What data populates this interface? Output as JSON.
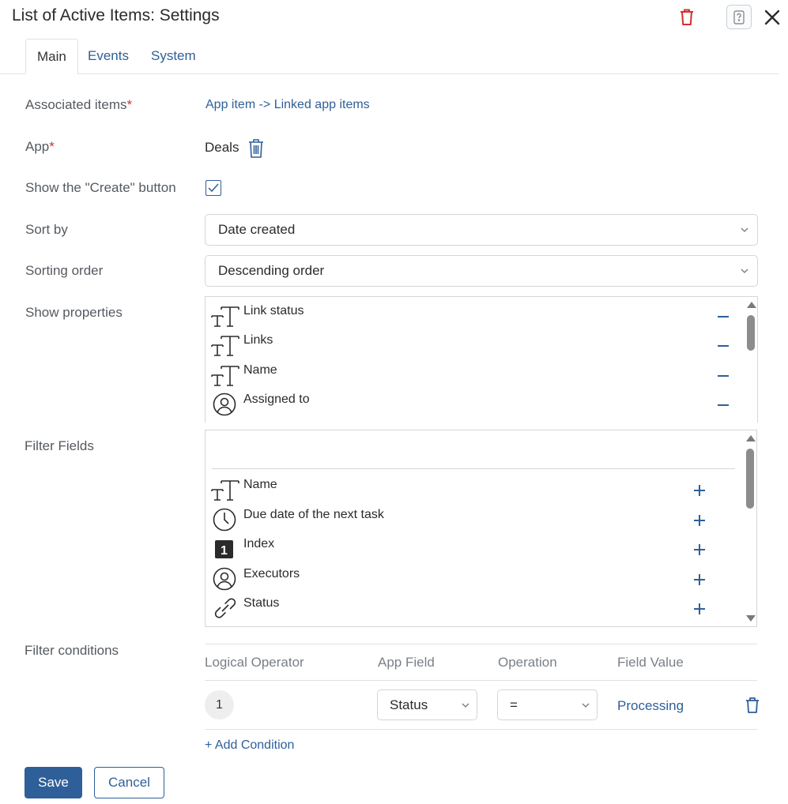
{
  "dialog": {
    "title": "List of Active Items: Settings"
  },
  "tabs": [
    {
      "label": "Main"
    },
    {
      "label": "Events"
    },
    {
      "label": "System"
    }
  ],
  "fields": {
    "associated_items": {
      "label": "Associated items",
      "required_mark": "*",
      "value": "App item -> Linked app items"
    },
    "app": {
      "label": "App",
      "required_mark": "*",
      "value": "Deals"
    },
    "show_create": {
      "label": "Show the \"Create\" button",
      "checked": true
    },
    "sort_by": {
      "label": "Sort by",
      "value": "Date created"
    },
    "sorting_order": {
      "label": "Sorting order",
      "value": "Descending order"
    },
    "show_properties": {
      "label": "Show properties"
    },
    "filter_fields": {
      "label": "Filter Fields"
    },
    "filter_conditions": {
      "label": "Filter conditions"
    }
  },
  "show_properties_items": [
    {
      "label": "Link status",
      "icon": "text-type-icon",
      "action": "remove"
    },
    {
      "label": "Links",
      "icon": "text-type-icon",
      "action": "remove"
    },
    {
      "label": "Name",
      "icon": "text-type-icon",
      "action": "remove"
    },
    {
      "label": "Assigned to",
      "icon": "user-icon",
      "action": "remove"
    }
  ],
  "filter_field_items": [
    {
      "label": "Name",
      "icon": "text-type-icon",
      "action": "add"
    },
    {
      "label": "Due date of the next task",
      "icon": "clock-icon",
      "action": "add"
    },
    {
      "label": "Index",
      "icon": "number-icon",
      "action": "add"
    },
    {
      "label": "Executors",
      "icon": "user-icon",
      "action": "add"
    },
    {
      "label": "Status",
      "icon": "link-icon",
      "action": "add"
    }
  ],
  "index_icon_glyph": "1",
  "conditions_table": {
    "headers": [
      "Logical Operator",
      "App Field",
      "Operation",
      "Field Value"
    ],
    "rows": [
      {
        "number": "1",
        "app_field": "Status",
        "operation": "=",
        "field_value": "Processing"
      }
    ],
    "add_condition": "+ Add Condition"
  },
  "buttons": {
    "save": "Save",
    "cancel": "Cancel"
  },
  "colors": {
    "accent": "#2f5f98",
    "danger": "#d32f2f",
    "border": "#d2d6db"
  }
}
